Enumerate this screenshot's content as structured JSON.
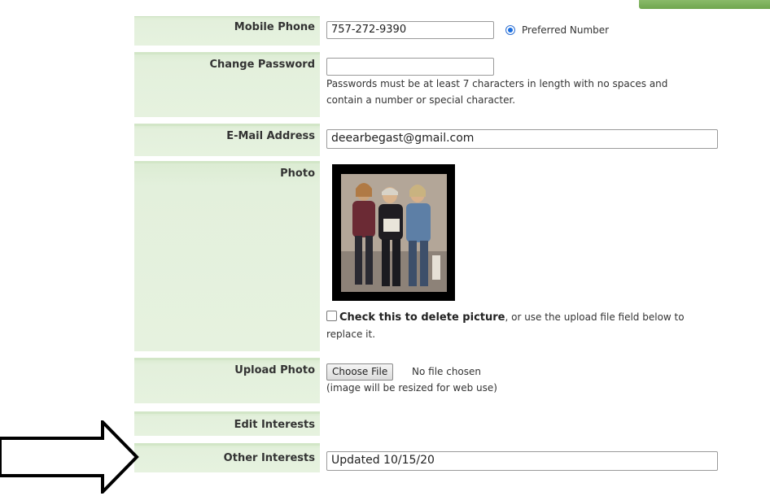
{
  "form": {
    "mobile_phone": {
      "label": "Mobile Phone",
      "value": "757-272-9390",
      "preferred_label": "Preferred Number"
    },
    "change_password": {
      "label": "Change Password",
      "value": "",
      "hint_line1": "Passwords must be at least 7 characters in length with no spaces and",
      "hint_line2": "contain a number or special character."
    },
    "email": {
      "label": "E-Mail Address",
      "value": "deearbegast@gmail.com"
    },
    "photo": {
      "label": "Photo",
      "delete_bold": "Check this to delete picture",
      "delete_rest": ", or use the upload file field below to",
      "delete_line2": "replace it."
    },
    "upload_photo": {
      "label": "Upload Photo",
      "button_label": "Choose File",
      "status": "No file chosen",
      "note": "(image will be resized for web use)"
    },
    "edit_interests": {
      "label": "Edit Interests"
    },
    "other_interests": {
      "label": "Other Interests",
      "value": "Updated 10/15/20"
    }
  },
  "colors": {
    "label_background": "#e6f2df",
    "accent_green": "#6fa64e",
    "radio_blue": "#1a6ee0"
  }
}
